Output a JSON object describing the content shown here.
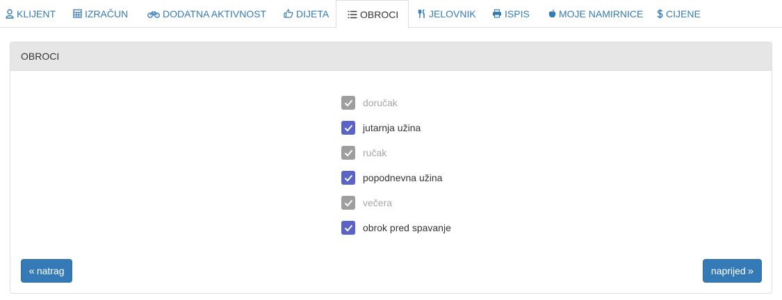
{
  "tabs": [
    {
      "label": "KLIJENT",
      "icon": "user-icon",
      "active": false
    },
    {
      "label": "IZRAČUN",
      "icon": "calculator-icon",
      "active": false
    },
    {
      "label": "DODATNA AKTIVNOST",
      "icon": "bicycle-icon",
      "active": false
    },
    {
      "label": "DIJETA",
      "icon": "thumbs-up-icon",
      "active": false
    },
    {
      "label": "OBROCI",
      "icon": "list-icon",
      "active": true
    },
    {
      "label": "JELOVNIK",
      "icon": "cutlery-icon",
      "active": false
    },
    {
      "label": "ISPIS",
      "icon": "print-icon",
      "active": false
    },
    {
      "label": "MOJE NAMIRNICE",
      "icon": "apple-icon",
      "active": false
    },
    {
      "label": "CIJENE",
      "icon": "dollar-icon",
      "active": false
    }
  ],
  "panel": {
    "title": "OBROCI"
  },
  "meals": [
    {
      "label": "doručak",
      "checked": true,
      "disabled": true
    },
    {
      "label": "jutarnja užina",
      "checked": true,
      "disabled": false
    },
    {
      "label": "ručak",
      "checked": true,
      "disabled": true
    },
    {
      "label": "popodnevna užina",
      "checked": true,
      "disabled": false
    },
    {
      "label": "večera",
      "checked": true,
      "disabled": true
    },
    {
      "label": "obrok pred spavanje",
      "checked": true,
      "disabled": false
    }
  ],
  "buttons": {
    "back_label": "natrag",
    "back_icon": "«",
    "next_label": "naprijed",
    "next_icon": "»"
  },
  "colors": {
    "link": "#337ab7",
    "primary_button": "#337ab7",
    "checkbox_active": "#5b63c4",
    "checkbox_disabled": "#9e9e9e",
    "text_disabled": "#a6a6a6"
  }
}
